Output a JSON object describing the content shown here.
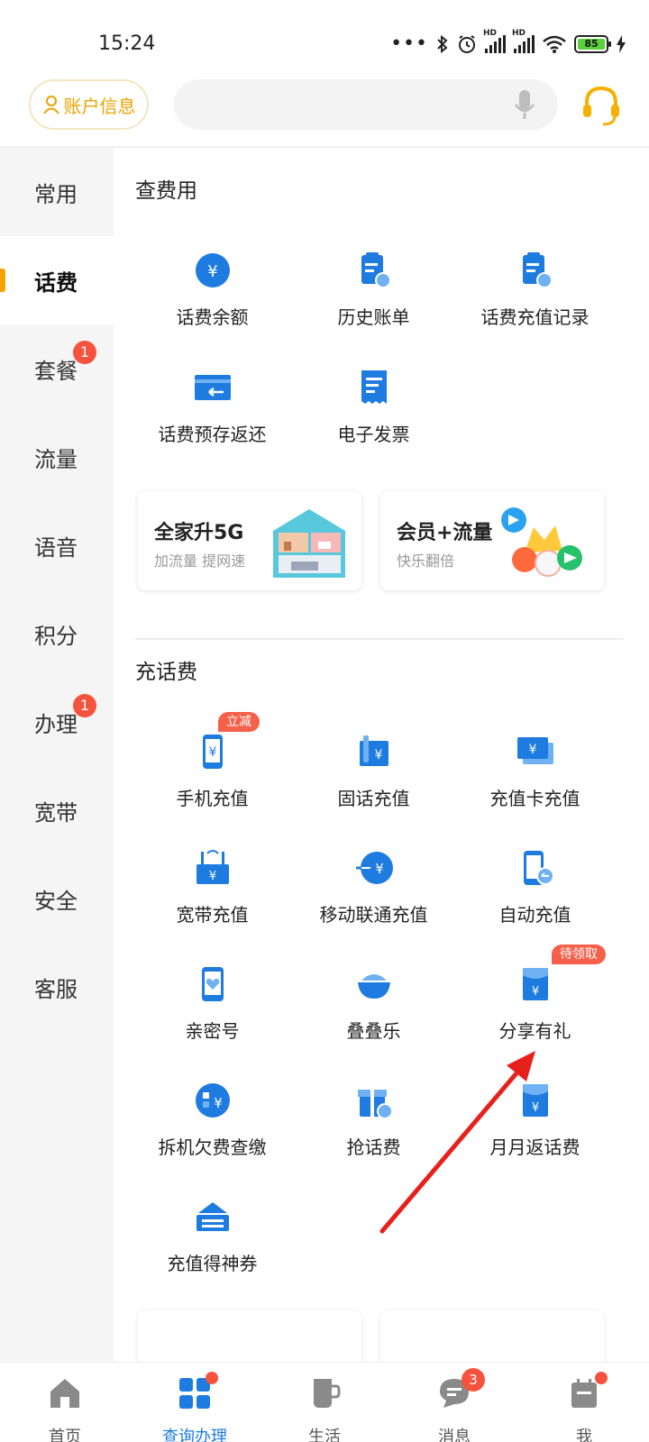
{
  "status_bar": {
    "time": "15:24",
    "battery": "85",
    "hd1": "HD",
    "hd2": "HD"
  },
  "header": {
    "account_label": "账户信息"
  },
  "sidebar": {
    "items": [
      {
        "label": "常用",
        "badge": ""
      },
      {
        "label": "话费",
        "badge": ""
      },
      {
        "label": "套餐",
        "badge": "1"
      },
      {
        "label": "流量",
        "badge": ""
      },
      {
        "label": "语音",
        "badge": ""
      },
      {
        "label": "积分",
        "badge": ""
      },
      {
        "label": "办理",
        "badge": "1"
      },
      {
        "label": "宽带",
        "badge": ""
      },
      {
        "label": "安全",
        "badge": ""
      },
      {
        "label": "客服",
        "badge": ""
      }
    ],
    "active": "话费"
  },
  "query": {
    "title": "查费用",
    "items": [
      {
        "label": "话费余额",
        "icon": "yuan-circle-icon"
      },
      {
        "label": "历史账单",
        "icon": "bill-clock-icon"
      },
      {
        "label": "话费充值记录",
        "icon": "recharge-record-icon"
      },
      {
        "label": "话费预存返还",
        "icon": "card-return-icon"
      },
      {
        "label": "电子发票",
        "icon": "invoice-icon"
      }
    ]
  },
  "promos": [
    {
      "title": "全家升5G",
      "subtitle": "加流量 提网速",
      "image": "house-illustration"
    },
    {
      "title": "会员+流量",
      "subtitle": "快乐翻倍",
      "image": "video-apps-illustration"
    }
  ],
  "recharge": {
    "title": "充话费",
    "items": [
      {
        "label": "手机充值",
        "tag": "立减",
        "icon": "phone-yuan-icon"
      },
      {
        "label": "固话充值",
        "tag": "",
        "icon": "landline-yuan-icon"
      },
      {
        "label": "充值卡充值",
        "tag": "",
        "icon": "card-yuan-icon"
      },
      {
        "label": "宽带充值",
        "tag": "",
        "icon": "router-yuan-icon"
      },
      {
        "label": "移动联通充值",
        "tag": "",
        "icon": "transfer-yuan-icon"
      },
      {
        "label": "自动充值",
        "tag": "",
        "icon": "auto-phone-icon"
      },
      {
        "label": "亲密号",
        "tag": "",
        "icon": "heart-phone-icon"
      },
      {
        "label": "叠叠乐",
        "tag": "",
        "icon": "bowl-icon"
      },
      {
        "label": "分享有礼",
        "tag": "待领取",
        "icon": "red-envelope-icon"
      },
      {
        "label": "拆机欠费查缴",
        "tag": "",
        "icon": "debt-yuan-icon"
      },
      {
        "label": "抢话费",
        "tag": "",
        "icon": "gift-yuan-icon"
      },
      {
        "label": "月月返话费",
        "tag": "",
        "icon": "envelope-yuan-icon"
      },
      {
        "label": "充值得神券",
        "tag": "",
        "icon": "coupon-stack-icon"
      }
    ]
  },
  "tabbar": {
    "items": [
      {
        "label": "首页",
        "badge": ""
      },
      {
        "label": "查询办理",
        "badge": "dot"
      },
      {
        "label": "生活",
        "badge": ""
      },
      {
        "label": "消息",
        "badge": "3"
      },
      {
        "label": "我",
        "badge": "dot"
      }
    ],
    "active": "查询办理"
  },
  "colors": {
    "accent_blue": "#1e7be0",
    "accent_orange": "#f5a300",
    "badge_red": "#f5533d",
    "arrow_red": "#e8201b"
  }
}
